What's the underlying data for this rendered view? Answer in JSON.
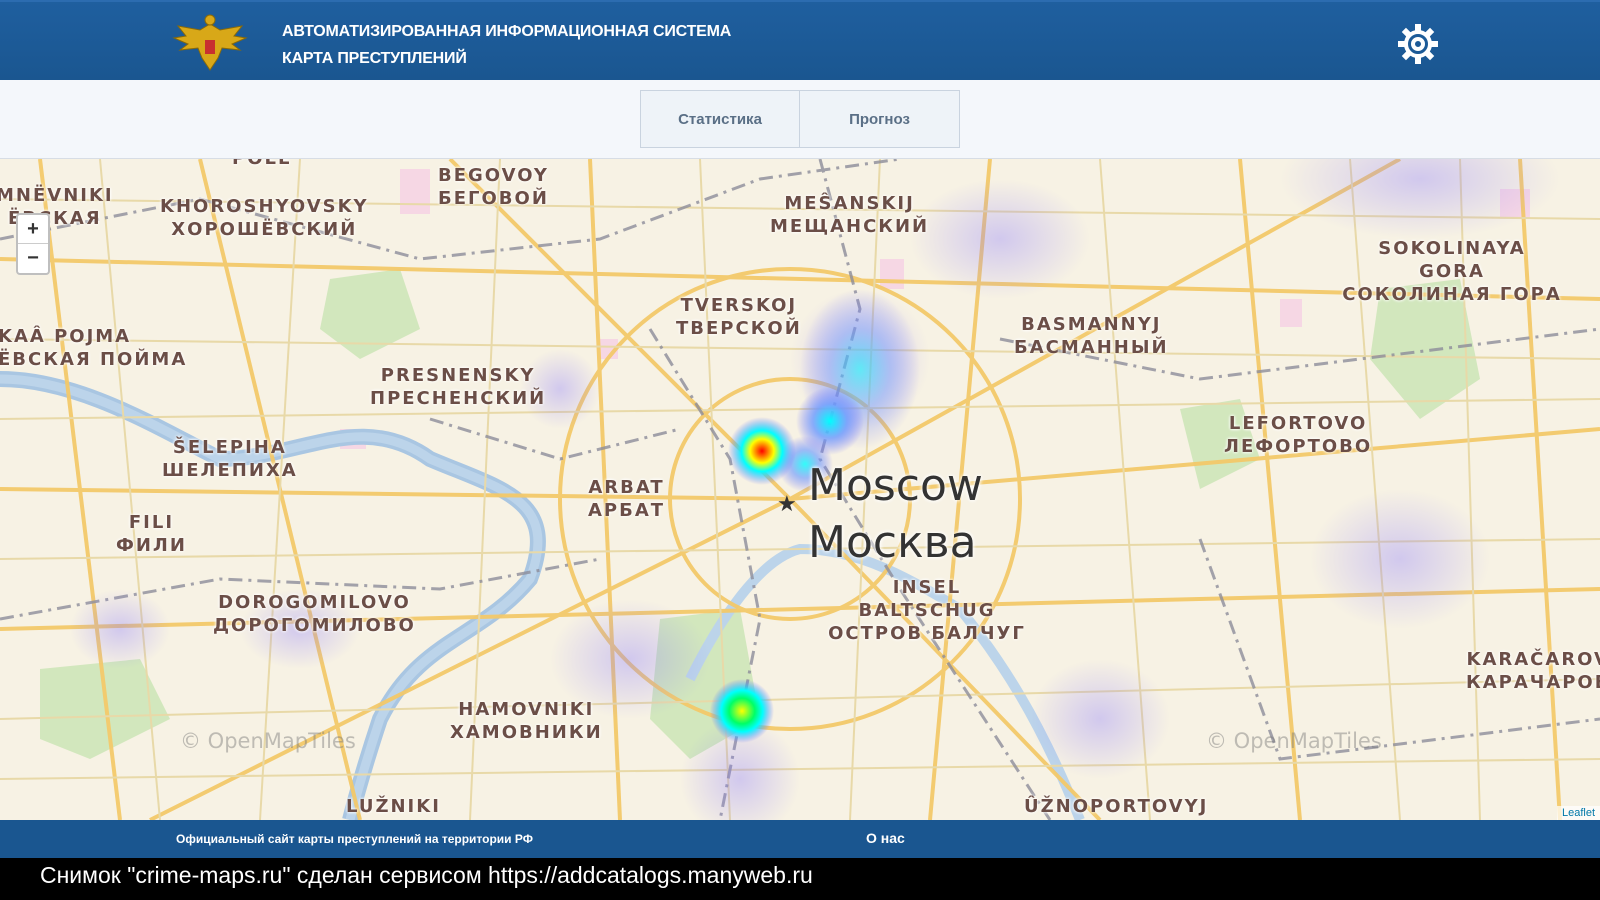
{
  "header": {
    "title_line1": "АВТОМАТИЗИРОВАННАЯ ИНФОРМАЦИОННАЯ СИСТЕМА",
    "title_line2": "КАРТА ПРЕСТУПЛЕНИЙ",
    "emblem_icon": "double-headed-eagle-icon",
    "settings_icon": "gear-icon"
  },
  "tabs": [
    {
      "label": "Статистика"
    },
    {
      "label": "Прогноз"
    }
  ],
  "map": {
    "zoom_in": "+",
    "zoom_out": "−",
    "city_latin": "Moscow",
    "city_cyrillic": "Москва",
    "attribution": "© OpenMapTiles",
    "leaflet": "Leaflet",
    "districts": [
      {
        "latin": "BEGOVOY",
        "cyrillic": "БЕГОВОЙ"
      },
      {
        "latin": "KHOROSHYOVSKY",
        "cyrillic": "ХОРОШЁВСКИЙ"
      },
      {
        "latin": "MEŜANSKIJ",
        "cyrillic": "МЕЩАНСКИЙ"
      },
      {
        "latin": "SOKOLINAYA GORA",
        "cyrillic": "СОКОЛИНАЯ ГОРА"
      },
      {
        "latin": "TVERSKOJ",
        "cyrillic": "ТВЕРСКОЙ"
      },
      {
        "latin": "BASMANNYJ",
        "cyrillic": "БАСМАННЫЙ"
      },
      {
        "latin": "PRESNENSKY",
        "cyrillic": "ПРЕСНЕНСКИЙ"
      },
      {
        "latin": "ŠELEPIHA",
        "cyrillic": "ШЕЛЕПИХА"
      },
      {
        "latin": "LEFORTOVO",
        "cyrillic": "ЛЕФОРТОВО"
      },
      {
        "latin": "ARBAT",
        "cyrillic": "АРБАТ"
      },
      {
        "latin": "FILI",
        "cyrillic": "ФИЛИ"
      },
      {
        "latin": "INSEL BALTSCHUG",
        "cyrillic": "ОСТРОВ БАЛЧУГ"
      },
      {
        "latin": "DOROGOMILOVO",
        "cyrillic": "ДОРОГОМИЛОВО"
      },
      {
        "latin": "HAMOVNIKI",
        "cyrillic": "ХАМОВНИКИ"
      },
      {
        "latin": "KARAČAROV",
        "cyrillic": "КАРАЧАРОВ"
      },
      {
        "latin": "MNËVNIKI",
        "cyrillic": "ЁВСКАЯ"
      },
      {
        "latin": "KAÂ POJMA",
        "cyrillic": "ЁВСКАЯ ПОЙМА"
      },
      {
        "latin": "LUŽNIKI",
        "cyrillic": ""
      },
      {
        "latin": "ÛŽNOPORTOVYJ",
        "cyrillic": ""
      },
      {
        "latin": "POLE",
        "cyrillic": ""
      }
    ]
  },
  "footer": {
    "site_text": "Официальный сайт карты преступлений на территории РФ",
    "about": "О нас"
  },
  "caption": "Снимок \"crime-maps.ru\" сделан сервисом https://addcatalogs.manyweb.ru",
  "colors": {
    "header_blue": "#1a5690",
    "heat_hot": "#ff0000",
    "heat_warm": "#ffff00",
    "heat_cool": "#00ffff"
  }
}
